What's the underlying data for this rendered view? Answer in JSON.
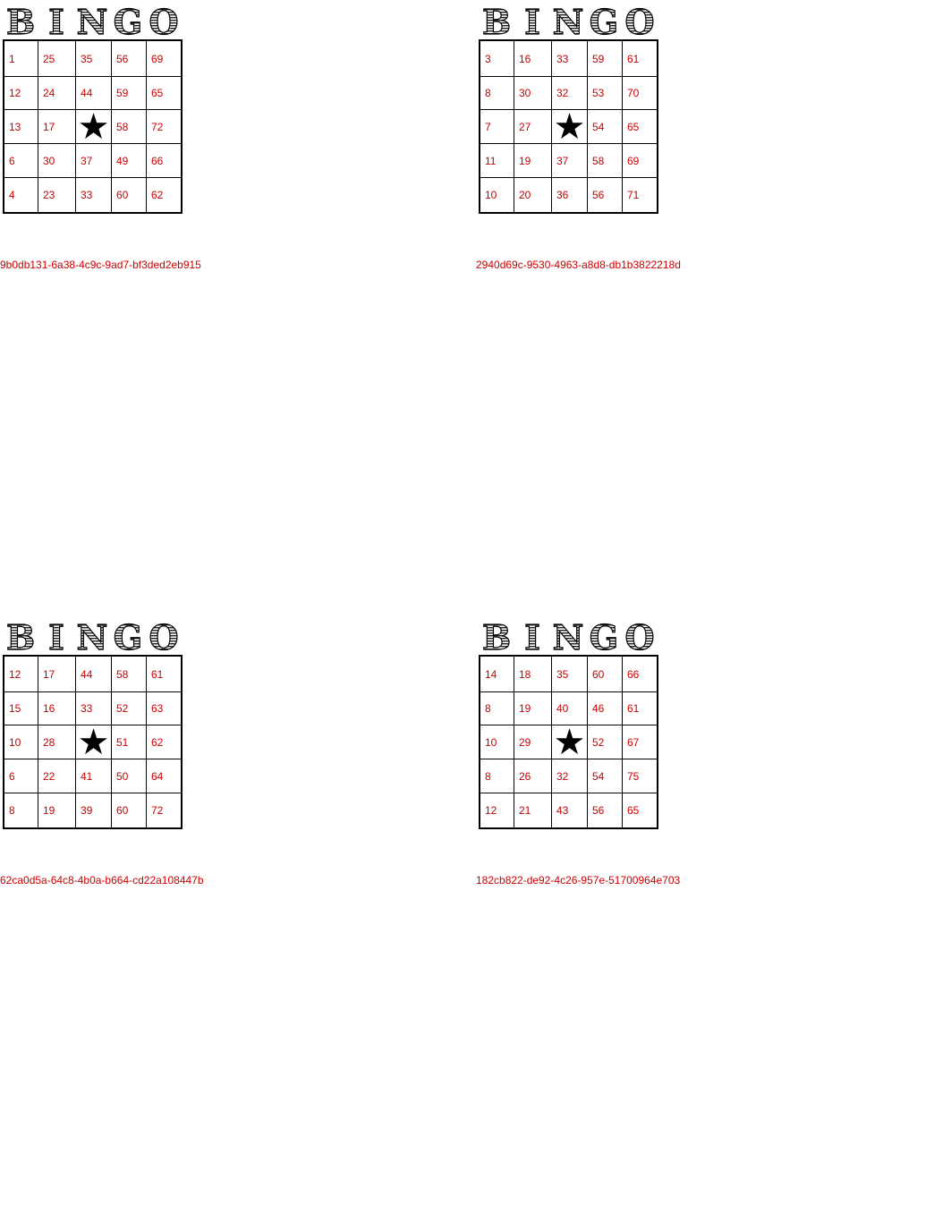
{
  "header_letters": [
    "B",
    "I",
    "N",
    "G",
    "O"
  ],
  "free_space_icon": "star-icon",
  "colors": {
    "number": "#cc0000",
    "border": "#000000",
    "background": "#ffffff"
  },
  "cards": [
    {
      "id": "9b0db131-6a38-4c9c-9ad7-bf3ded2eb915",
      "rows": [
        [
          "1",
          "25",
          "35",
          "56",
          "69"
        ],
        [
          "12",
          "24",
          "44",
          "59",
          "65"
        ],
        [
          "13",
          "17",
          "",
          "58",
          "72"
        ],
        [
          "6",
          "30",
          "37",
          "49",
          "66"
        ],
        [
          "4",
          "23",
          "33",
          "60",
          "62"
        ]
      ]
    },
    {
      "id": "2940d69c-9530-4963-a8d8-db1b3822218d",
      "rows": [
        [
          "3",
          "16",
          "33",
          "59",
          "61"
        ],
        [
          "8",
          "30",
          "32",
          "53",
          "70"
        ],
        [
          "7",
          "27",
          "",
          "54",
          "65"
        ],
        [
          "11",
          "19",
          "37",
          "58",
          "69"
        ],
        [
          "10",
          "20",
          "36",
          "56",
          "71"
        ]
      ]
    },
    {
      "id": "62ca0d5a-64c8-4b0a-b664-cd22a108447b",
      "rows": [
        [
          "12",
          "17",
          "44",
          "58",
          "61"
        ],
        [
          "15",
          "16",
          "33",
          "52",
          "63"
        ],
        [
          "10",
          "28",
          "",
          "51",
          "62"
        ],
        [
          "6",
          "22",
          "41",
          "50",
          "64"
        ],
        [
          "8",
          "19",
          "39",
          "60",
          "72"
        ]
      ]
    },
    {
      "id": "182cb822-de92-4c26-957e-51700964e703",
      "rows": [
        [
          "14",
          "18",
          "35",
          "60",
          "66"
        ],
        [
          "8",
          "19",
          "40",
          "46",
          "61"
        ],
        [
          "10",
          "29",
          "",
          "52",
          "67"
        ],
        [
          "8",
          "26",
          "32",
          "54",
          "75"
        ],
        [
          "12",
          "21",
          "43",
          "56",
          "65"
        ]
      ]
    }
  ]
}
